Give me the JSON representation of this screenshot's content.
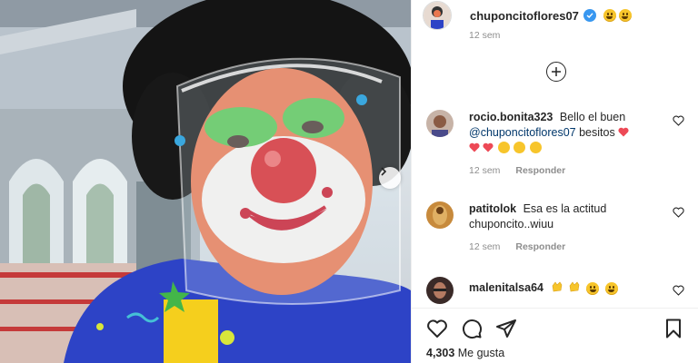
{
  "post": {
    "username": "chuponcito​flores07",
    "verified": true,
    "age": "12 sem",
    "likes_count": "4,303",
    "likes_label": "Me gusta"
  },
  "comments": [
    {
      "user": "rocio.bonita323",
      "text_before": "Bello el buen",
      "mention": "@chuponcitoflores07",
      "text_after": "besitos",
      "age": "12 sem",
      "reply": "Responder"
    },
    {
      "user": "patitolok",
      "text_before": "Esa es la actitud chuponcito..wiuu",
      "age": "12 sem",
      "reply": "Responder"
    },
    {
      "user": "malenitalsa64"
    }
  ],
  "icons": {
    "verified": "verified-badge-icon",
    "load_more": "plus-circle-icon",
    "like": "heart-outline-icon",
    "comment": "comment-bubble-icon",
    "share": "paper-plane-icon",
    "save": "bookmark-icon",
    "next": "chevron-right-icon"
  },
  "colors": {
    "verified_blue": "#3897f0",
    "text": "#262626",
    "muted": "#8e8e8e",
    "mention": "#00376b",
    "heart_red": "#ed4956"
  }
}
